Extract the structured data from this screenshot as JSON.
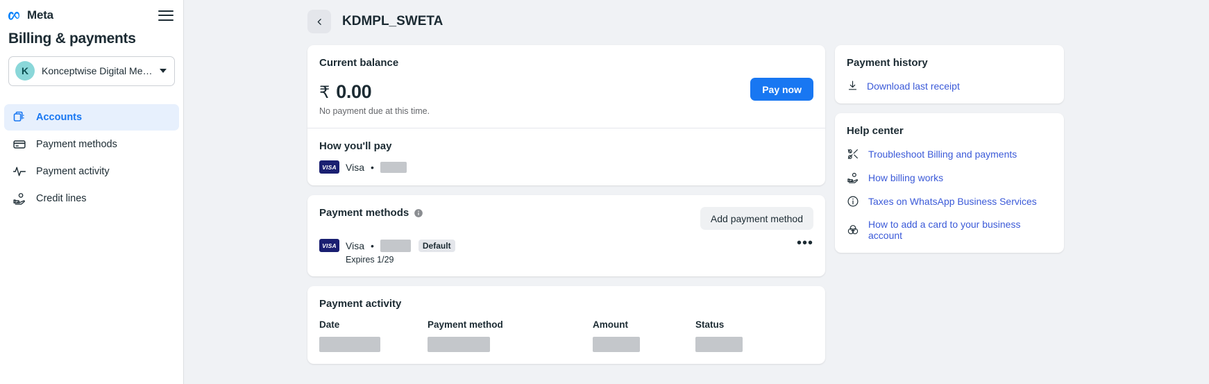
{
  "sidebar": {
    "brand": "Meta",
    "menu_icon": "hamburger-icon",
    "title": "Billing & payments",
    "account": {
      "avatar_initial": "K",
      "name": "Konceptwise Digital Medi...",
      "caret_icon": "chevron-down-icon"
    },
    "items": [
      {
        "label": "Accounts",
        "icon": "accounts-icon",
        "active": true
      },
      {
        "label": "Payment methods",
        "icon": "credit-card-icon",
        "active": false
      },
      {
        "label": "Payment activity",
        "icon": "activity-pulse-icon",
        "active": false
      },
      {
        "label": "Credit lines",
        "icon": "hand-coin-icon",
        "active": false
      }
    ]
  },
  "header": {
    "back_icon": "chevron-left-icon",
    "title": "KDMPL_SWETA"
  },
  "balance": {
    "section_title": "Current balance",
    "currency_symbol": "₹",
    "amount": "0.00",
    "note": "No payment due at this time.",
    "pay_button": "Pay now",
    "how_title": "How you'll pay",
    "card_brand": "Visa",
    "card_badge_text": "VISA",
    "card_separator": "•"
  },
  "payment_methods": {
    "section_title": "Payment methods",
    "info_icon": "info-icon",
    "add_button": "Add payment method",
    "card_badge_text": "VISA",
    "card_brand": "Visa",
    "card_separator": "•",
    "default_badge": "Default",
    "expires": "Expires 1/29",
    "overflow_icon": "ellipsis-icon",
    "overflow_glyph": "•••"
  },
  "payment_activity": {
    "section_title": "Payment activity",
    "columns": [
      "Date",
      "Payment method",
      "Amount",
      "Status"
    ],
    "rows": [
      {
        "date": "",
        "method": "",
        "amount": "",
        "status": ""
      }
    ]
  },
  "payment_history": {
    "section_title": "Payment history",
    "download_icon": "download-icon",
    "download_link": "Download last receipt"
  },
  "help_center": {
    "section_title": "Help center",
    "links": [
      {
        "label": "Troubleshoot Billing and payments",
        "icon": "wrench-screwdriver-icon"
      },
      {
        "label": "How billing works",
        "icon": "hand-coin-icon"
      },
      {
        "label": "Taxes on WhatsApp Business Services",
        "icon": "info-circle-icon"
      },
      {
        "label": "How to add a card to your business account",
        "icon": "venn-circles-icon"
      }
    ]
  },
  "colors": {
    "accent_blue": "#1877f2",
    "link_blue": "#3b5ad8",
    "visa_navy": "#1a1f71",
    "page_bg": "#f0f2f5",
    "avatar_teal": "#8ad7d9",
    "redaction_gray": "#c4c7cb"
  }
}
